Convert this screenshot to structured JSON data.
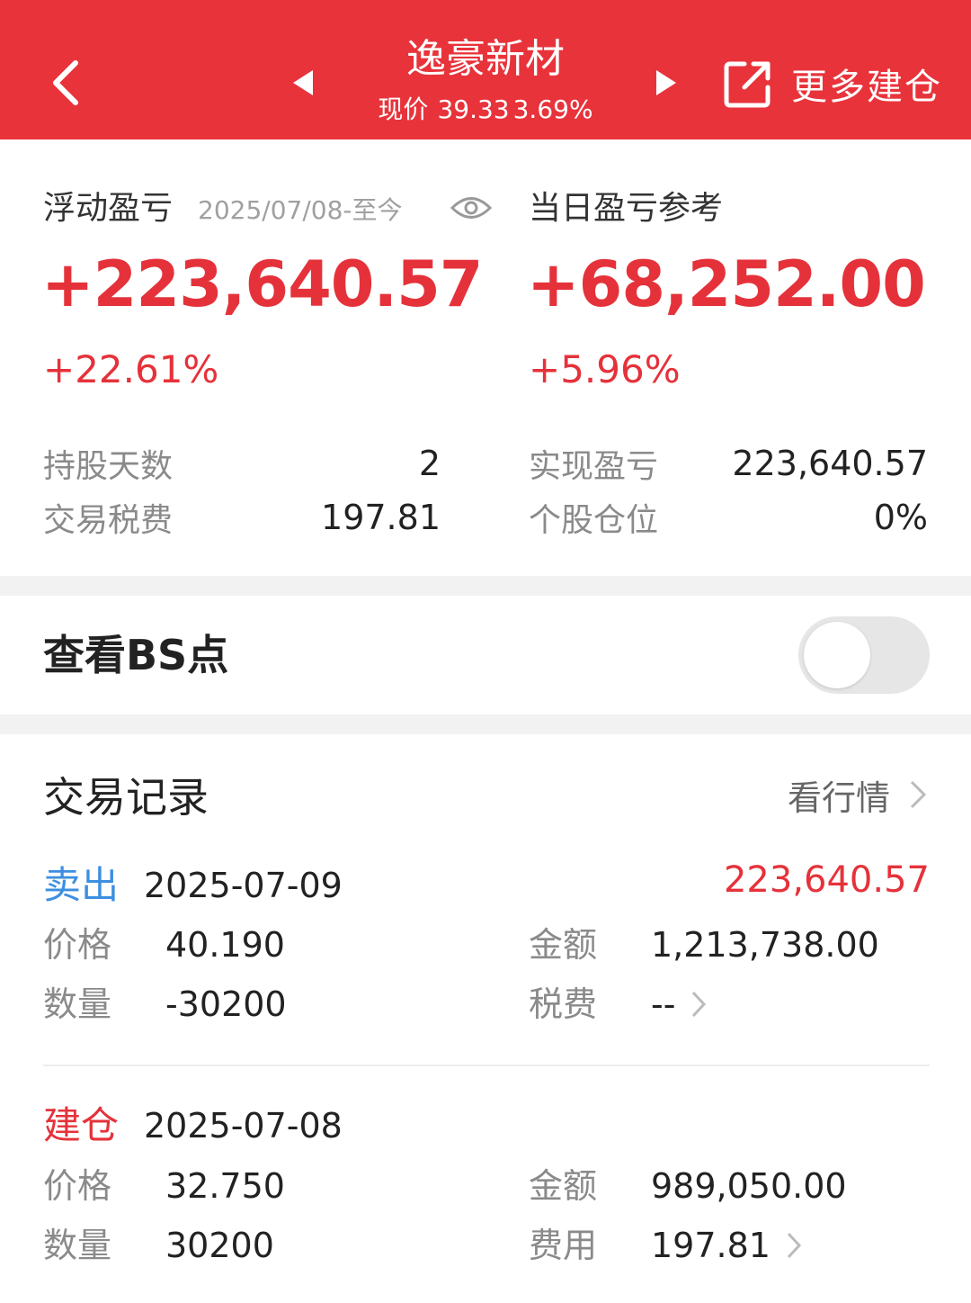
{
  "header": {
    "title": "逸豪新材",
    "price_label": "现价",
    "price": "39.33",
    "change_pct": "3.69%",
    "more_label": "更多建仓"
  },
  "summary": {
    "floating": {
      "label": "浮动盈亏",
      "date_range": "2025/07/08-至今",
      "amount": "+223,640.57",
      "pct": "+22.61%"
    },
    "daily": {
      "label": "当日盈亏参考",
      "amount": "+68,252.00",
      "pct": "+5.96%"
    },
    "stats": {
      "holding_days_label": "持股天数",
      "holding_days": "2",
      "tax_label": "交易税费",
      "tax": "197.81",
      "realized_label": "实现盈亏",
      "realized": "223,640.57",
      "position_label": "个股仓位",
      "position": "0%"
    }
  },
  "bs_toggle": {
    "label": "查看BS点",
    "on": false
  },
  "records": {
    "title": "交易记录",
    "link_label": "看行情",
    "items": [
      {
        "type": "卖出",
        "date": "2025-07-09",
        "profit": "223,640.57",
        "price_label": "价格",
        "price": "40.190",
        "amount_label": "金额",
        "amount": "1,213,738.00",
        "qty_label": "数量",
        "qty": "-30200",
        "fee_label": "税费",
        "fee": "--"
      },
      {
        "type": "建仓",
        "date": "2025-07-08",
        "price_label": "价格",
        "price": "32.750",
        "amount_label": "金额",
        "amount": "989,050.00",
        "qty_label": "数量",
        "qty": "30200",
        "fee_label": "费用",
        "fee": "197.81"
      }
    ]
  },
  "colors": {
    "header_bg": "#e8333b",
    "profit_red": "#e5323a",
    "sell_blue": "#3c8fe0"
  }
}
